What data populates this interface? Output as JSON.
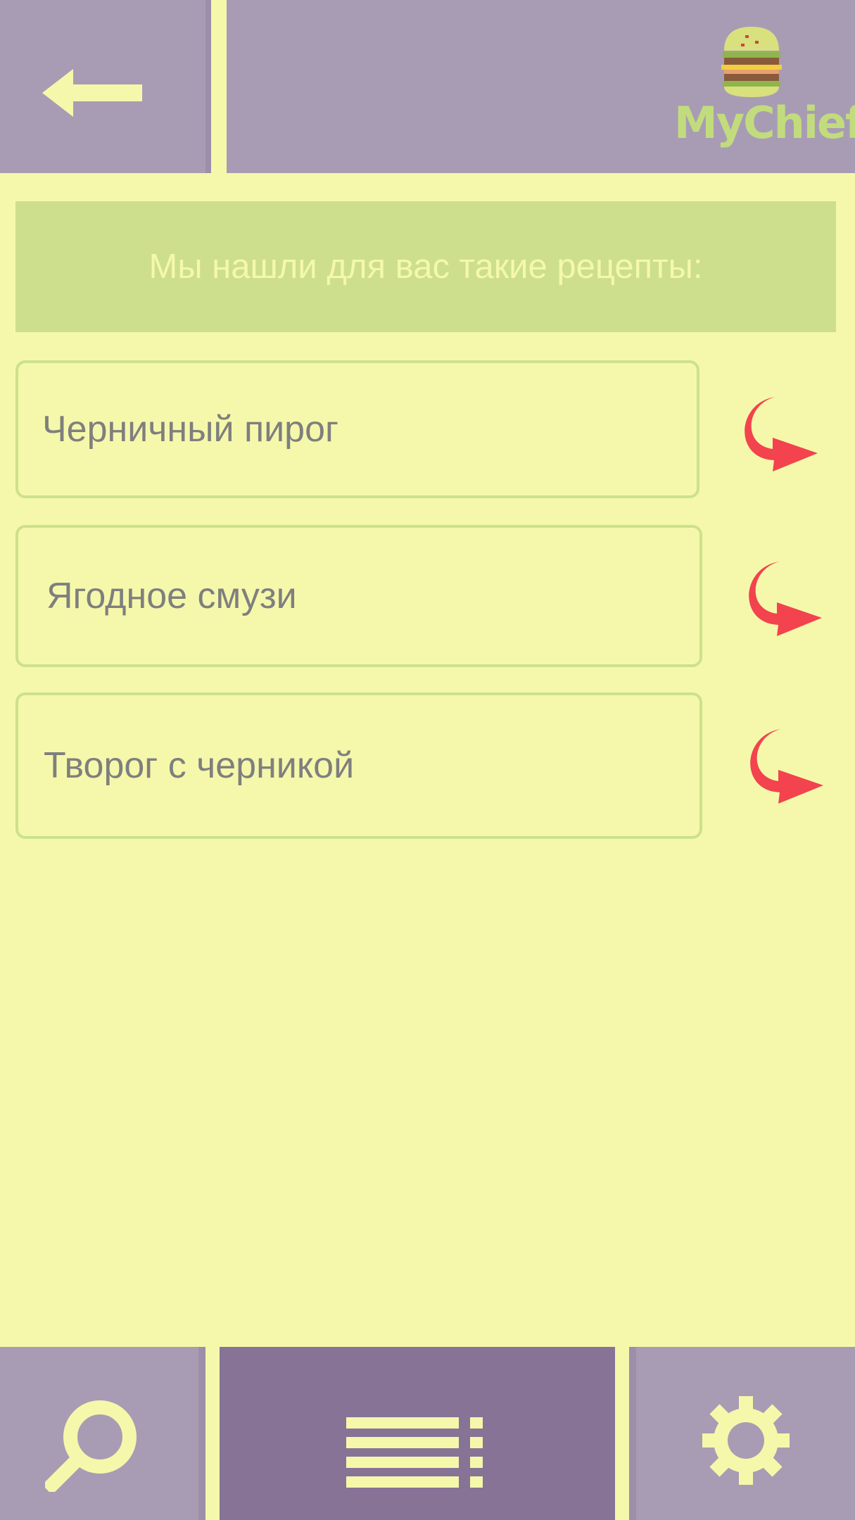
{
  "header": {
    "back_icon": "arrow-left-icon",
    "logo_text": "MyChief",
    "logo_icon": "burger-icon"
  },
  "banner": {
    "text": "Мы нашли для вас такие рецепты:"
  },
  "recipes": [
    {
      "name": "Черничный пирог",
      "action_icon": "curved-arrow-right-icon"
    },
    {
      "name": "Ягодное смузи",
      "action_icon": "curved-arrow-right-icon"
    },
    {
      "name": "Творог с черникой",
      "action_icon": "curved-arrow-right-icon"
    }
  ],
  "bottom_nav": {
    "items": [
      {
        "icon": "search-icon",
        "active": false
      },
      {
        "icon": "list-menu-icon",
        "active": true
      },
      {
        "icon": "gear-icon",
        "active": false
      }
    ]
  },
  "colors": {
    "background": "#f5f8aa",
    "panel": "#a89cb4",
    "panel_active": "#877396",
    "accent_green": "#cddf8d",
    "logo_green": "#c2dc7d",
    "arrow_red": "#f2434e",
    "text_gray": "#7f7f7f"
  }
}
